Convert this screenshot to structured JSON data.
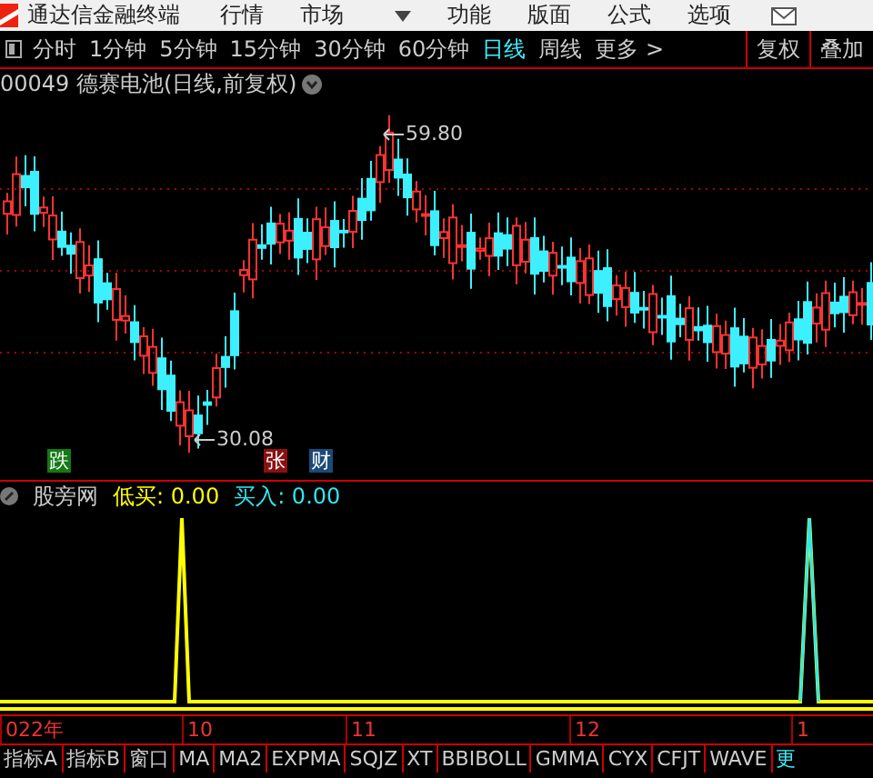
{
  "menu_bar": {
    "app_title": "通达信金融终端",
    "items": [
      "行情",
      "市场",
      "功能",
      "版面",
      "公式",
      "选项"
    ]
  },
  "period_tabs": [
    {
      "label": "分时",
      "selected": false
    },
    {
      "label": "1分钟",
      "selected": false
    },
    {
      "label": "5分钟",
      "selected": false
    },
    {
      "label": "15分钟",
      "selected": false
    },
    {
      "label": "30分钟",
      "selected": false
    },
    {
      "label": "60分钟",
      "selected": false
    },
    {
      "label": "日线",
      "selected": true
    },
    {
      "label": "周线",
      "selected": false
    },
    {
      "label": "更多 >",
      "selected": false
    }
  ],
  "right_buttons": [
    "复权",
    "叠加"
  ],
  "chart": {
    "title": "00049 德赛电池(日线,前复权)",
    "high_label": "59.80",
    "low_label": "30.08",
    "events": [
      {
        "label": "跌",
        "color": "#137a13"
      },
      {
        "label": "张",
        "color": "#8a1010"
      },
      {
        "label": "财",
        "color": "#1a4a78"
      }
    ]
  },
  "indicator": {
    "name": "股旁网",
    "legend": [
      {
        "text": "低买: 0.00",
        "color": "#ffff00"
      },
      {
        "text": "买入: 0.00",
        "color": "#2ee8f0"
      }
    ]
  },
  "time_axis": [
    "022年",
    "10",
    "11",
    "12",
    "1"
  ],
  "bottom_tabs": [
    "指标A",
    "指标B",
    "窗口",
    "MA",
    "MA2",
    "EXPMA",
    "SQJZ",
    "XT",
    "BBIBOLL",
    "GMMA",
    "CYX",
    "CFJT",
    "WAVE",
    "更"
  ]
}
